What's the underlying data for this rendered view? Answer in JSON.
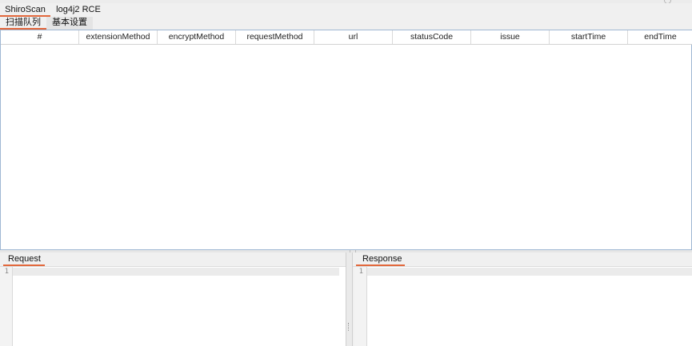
{
  "tabs": {
    "main": [
      {
        "label": "ShiroScan",
        "active": true
      },
      {
        "label": "log4j2 RCE",
        "active": false
      }
    ],
    "sub": [
      {
        "label": "扫描队列",
        "active": true
      },
      {
        "label": "基本设置",
        "active": false
      }
    ]
  },
  "table": {
    "columns": [
      "#",
      "extensionMethod",
      "encryptMethod",
      "requestMethod",
      "url",
      "statusCode",
      "issue",
      "startTime",
      "endTime"
    ],
    "rows": []
  },
  "request_pane": {
    "tab_label": "Request",
    "line_numbers": [
      "1"
    ]
  },
  "response_pane": {
    "tab_label": "Response",
    "line_numbers": [
      "1"
    ]
  },
  "colors": {
    "accent": "#e2683c",
    "table_border": "#9fb7d3"
  }
}
